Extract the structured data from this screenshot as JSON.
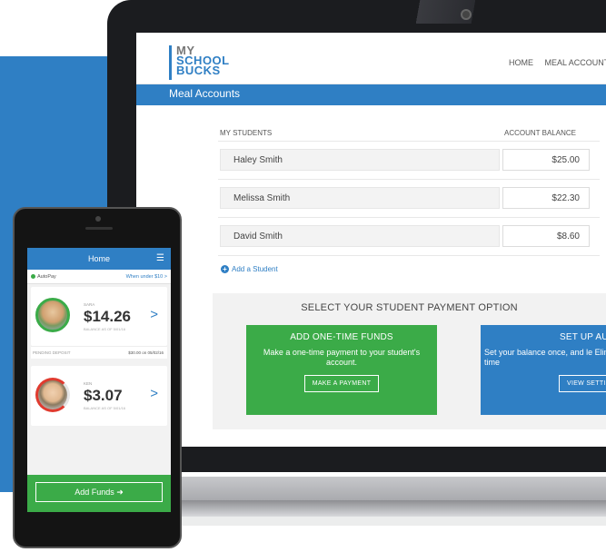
{
  "laptop": {
    "logo": {
      "line1": "MY",
      "line2": "SCHOOL",
      "line3": "BUCKS"
    },
    "nav": [
      "HOME",
      "MEAL ACCOUNTS",
      "S"
    ],
    "page_title": "Meal Accounts",
    "table": {
      "col_students": "MY STUDENTS",
      "col_balance": "ACCOUNT BALANCE",
      "rows": [
        {
          "name": "Haley Smith",
          "balance": "$25.00"
        },
        {
          "name": "Melissa Smith",
          "balance": "$22.30"
        },
        {
          "name": "David Smith",
          "balance": "$8.60"
        }
      ]
    },
    "add_student": "Add a Student",
    "payment": {
      "title": "SELECT YOUR STUDENT PAYMENT OPTION",
      "one_time": {
        "heading": "ADD ONE-TIME FUNDS",
        "text": "Make a one-time payment to your student's account.",
        "button": "MAKE A PAYMENT"
      },
      "autopay": {
        "heading": "SET UP AUTO",
        "text": "Set your balance once, and le Eliminate one-time",
        "button": "VIEW SETTIN"
      }
    }
  },
  "phone": {
    "header": "Home",
    "menu_icon": "☰",
    "autopay_label": "AutoPay",
    "autopay_when": "When under $10 >",
    "kids": [
      {
        "name": "SARA",
        "amount": "$14.26",
        "asof": "BALANCE AS OF 5/01/16"
      },
      {
        "name": "KEN",
        "amount": "$3.07",
        "asof": "BALANCE AS OF 5/01/16"
      }
    ],
    "pending_label": "PENDING DEPOSIT",
    "pending_value": "$30.00 on 05/02/16",
    "chevron": ">",
    "add_funds": "Add Funds ➜"
  },
  "colors": {
    "brand_blue": "#2f7fc4",
    "green": "#3bab48",
    "red": "#e03b2f"
  }
}
